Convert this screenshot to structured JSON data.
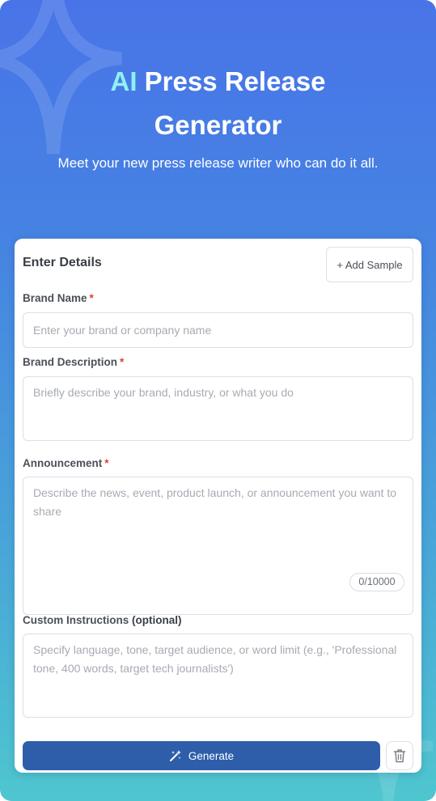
{
  "hero": {
    "title_accent": "AI",
    "title_rest": "Press Release",
    "title_line2": "Generator",
    "subtitle": "Meet your new press release writer who can do it all."
  },
  "form": {
    "title": "Enter Details",
    "add_sample_label": "+ Add Sample",
    "required_marker": "*",
    "brand_name": {
      "label": "Brand Name",
      "placeholder": "Enter your brand or company name"
    },
    "brand_description": {
      "label": "Brand Description",
      "placeholder": "Briefly describe your brand, industry, or what you do"
    },
    "announcement": {
      "label": "Announcement",
      "placeholder": "Describe the news, event, product launch, or announcement you want to share",
      "counter": "0/10000"
    },
    "custom_instructions": {
      "label": "Custom Instructions",
      "label_suffix": "(optional)",
      "placeholder": "Specify language, tone, target audience, or word limit (e.g., 'Professional tone, 400 words, target tech journalists')"
    },
    "generate_label": "Generate"
  },
  "icons": {
    "generate": "magic-wand-icon",
    "clear": "trash-icon"
  },
  "colors": {
    "gradient_top": "#4874e8",
    "gradient_bottom": "#4fc6cf",
    "accent_text": "#8ff1f2",
    "primary_button": "#2e5eaa",
    "required": "#e23b3b"
  }
}
